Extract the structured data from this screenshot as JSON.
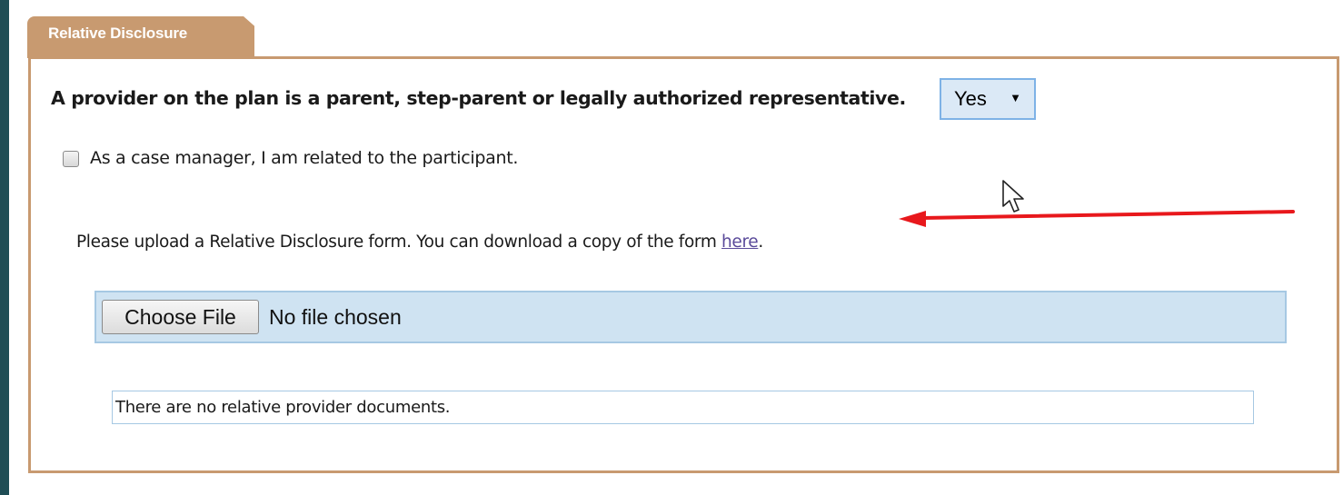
{
  "section": {
    "tab_label": "Relative Disclosure"
  },
  "question": {
    "text": "A provider on the plan is a parent, step-parent or legally authorized representative.",
    "select_value": "Yes"
  },
  "checkbox": {
    "label": "As a case manager, I am related to the participant.",
    "checked": false
  },
  "instruction": {
    "text": "Please upload a Relative Disclosure form. You can download a copy of the form ",
    "link_text": "here",
    "suffix": "."
  },
  "file_input": {
    "button_label": "Choose File",
    "status": "No file chosen"
  },
  "documents": {
    "empty_message": "There are no relative provider documents."
  },
  "annotation": {
    "arrow_color": "#e8181c",
    "cursor_icon": "mouse-pointer-icon"
  },
  "colors": {
    "tab_bg": "#c89a70",
    "panel_border": "#c89a70",
    "file_bar_bg": "#cfe3f2",
    "select_bg": "#dbe9f6"
  }
}
